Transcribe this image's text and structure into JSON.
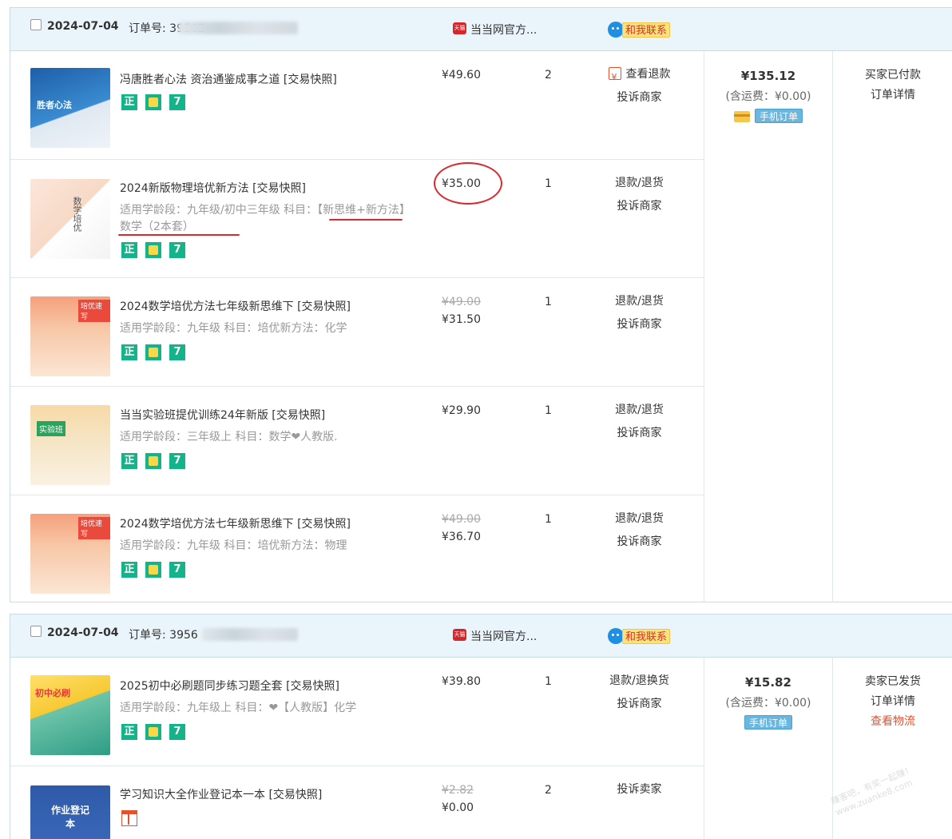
{
  "orders": [
    {
      "date": "2024-07-04",
      "order_no_label": "订单号: 39562",
      "shop": "当当网官方...",
      "tmall_badge": "天猫",
      "contact_label": "和我联系",
      "total": "¥135.12",
      "shipping": "(含运费：¥0.00)",
      "mobile_tag": "手机订单",
      "status": [
        "买家已付款",
        "订单详情"
      ],
      "items": [
        {
          "title": "冯唐胜者心法 资治通鉴成事之道 [交易快照]",
          "attr": "",
          "old_price": "",
          "price": "¥49.60",
          "qty": "2",
          "ops": [
            "查看退款",
            "投诉商家"
          ],
          "thumb_text": "胜者心法"
        },
        {
          "title": "2024新版物理培优新方法 [交易快照]",
          "attr": "适用学龄段：九年级/初中三年级   科目：【新思维+新方法】数学（2本套）",
          "old_price": "",
          "price": "¥35.00",
          "qty": "1",
          "ops": [
            "退款/退货",
            "投诉商家"
          ],
          "thumb_text": "数学培优"
        },
        {
          "title": "2024数学培优方法七年级新思维下 [交易快照]",
          "attr": "适用学龄段：九年级   科目：培优新方法：化学",
          "old_price": "¥49.00",
          "price": "¥31.50",
          "qty": "1",
          "ops": [
            "退款/退货",
            "投诉商家"
          ],
          "thumb_text": "培优速写"
        },
        {
          "title": "当当实验班提优训练24年新版 [交易快照]",
          "attr": "适用学龄段：三年级上   科目：数学❤人教版.",
          "old_price": "",
          "price": "¥29.90",
          "qty": "1",
          "ops": [
            "退款/退货",
            "投诉商家"
          ],
          "thumb_text": "实验班"
        },
        {
          "title": "2024数学培优方法七年级新思维下 [交易快照]",
          "attr": "适用学龄段：九年级   科目：培优新方法：物理",
          "old_price": "¥49.00",
          "price": "¥36.70",
          "qty": "1",
          "ops": [
            "退款/退货",
            "投诉商家"
          ],
          "thumb_text": "培优速写"
        }
      ]
    },
    {
      "date": "2024-07-04",
      "order_no_label": "订单号: 3956",
      "shop": "当当网官方...",
      "tmall_badge": "天猫",
      "contact_label": "和我联系",
      "total": "¥15.82",
      "shipping": "(含运费：¥0.00)",
      "mobile_tag": "手机订单",
      "status": [
        "卖家已发货",
        "订单详情",
        "查看物流"
      ],
      "items": [
        {
          "title": "2025初中必刷题同步练习题全套 [交易快照]",
          "attr": "适用学龄段：九年级上   科目：❤【人教版】化学",
          "old_price": "",
          "price": "¥39.80",
          "qty": "1",
          "ops": [
            "退款/退换货",
            "投诉商家"
          ],
          "thumb_text": "初中必刷"
        },
        {
          "title": "学习知识大全作业登记本一本 [交易快照]",
          "attr": "",
          "old_price": "¥2.82",
          "price": "¥0.00",
          "qty": "2",
          "ops": [
            "投诉卖家"
          ],
          "thumb_text": "作业登记本"
        }
      ]
    }
  ],
  "badges": {
    "zheng": "正",
    "seven": "7"
  },
  "watermark": [
    "赚客吧，有奖一起赚！",
    "www.zuanke8.com"
  ],
  "colors": {
    "header_bg": "#eaf5fb",
    "border": "#c8dbe6",
    "accent_red": "#d9282f",
    "badge_green": "#15b38a"
  }
}
